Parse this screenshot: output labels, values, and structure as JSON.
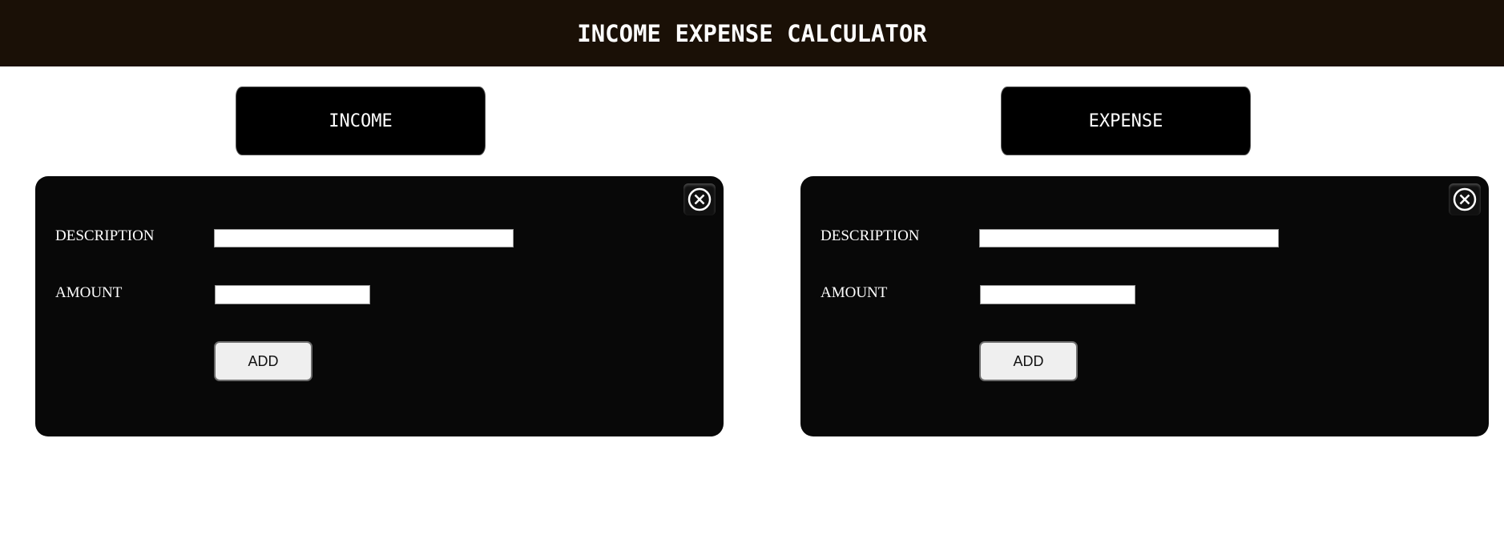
{
  "header": {
    "title": "INCOME EXPENSE CALCULATOR"
  },
  "tabs": {
    "income_label": "INCOME",
    "expense_label": "EXPENSE"
  },
  "income_panel": {
    "description_label": "DESCRIPTION",
    "description_value": "",
    "amount_label": "AMOUNT",
    "amount_value": "",
    "add_label": "ADD",
    "close_icon": "close-circle-icon"
  },
  "expense_panel": {
    "description_label": "DESCRIPTION",
    "description_value": "",
    "amount_label": "AMOUNT",
    "amount_value": "",
    "add_label": "ADD",
    "close_icon": "close-circle-icon"
  },
  "colors": {
    "header_bg": "#1a1006",
    "panel_bg": "#080808",
    "tab_bg": "#000000",
    "button_bg": "#efefef"
  }
}
